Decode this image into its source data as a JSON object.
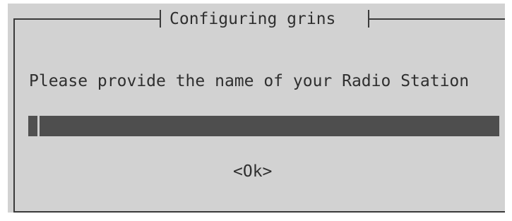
{
  "dialog": {
    "title": "Configuring grins",
    "prompt": "Please provide the name of your Radio Station",
    "input": {
      "value": ""
    },
    "ok_label": "<Ok>"
  },
  "colors": {
    "dialog_background": "#d2d2d2",
    "frame_line": "#3a3a3a",
    "input_background": "#4e4e4e",
    "text": "#2f2f2f"
  }
}
